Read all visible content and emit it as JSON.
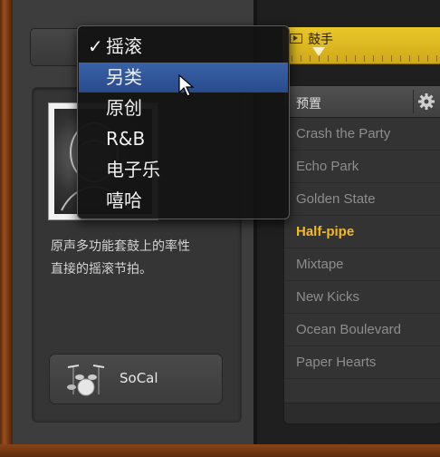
{
  "genre_menu": {
    "selected": "摇滚",
    "highlighted": "另类",
    "items": [
      "摇滚",
      "另类",
      "原创",
      "R&B",
      "电子乐",
      "嘻哈"
    ]
  },
  "drummer": {
    "description_line1": "原声多功能套鼓上的率性",
    "description_line2": "直接的摇滚节拍。",
    "kit_name": "SoCal"
  },
  "track": {
    "name": "鼓手"
  },
  "presets": {
    "header": "预置",
    "items": [
      "Crash the Party",
      "Echo Park",
      "Golden State",
      "Half-pipe",
      "Mixtape",
      "New Kicks",
      "Ocean Boulevard",
      "Paper Hearts"
    ],
    "active": "Half-pipe"
  },
  "colors": {
    "highlight": "#2f579b",
    "active_preset": "#f0b92a",
    "region": "#e0bd22"
  }
}
